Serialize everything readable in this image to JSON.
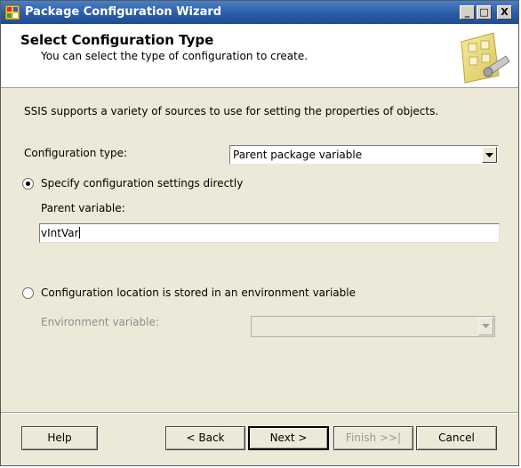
{
  "window": {
    "title": "Package Configuration Wizard",
    "controls": {
      "minimize": "_",
      "maximize": "□",
      "close": "X"
    }
  },
  "header": {
    "title": "Select Configuration Type",
    "subtitle": "You can select the type of configuration to create."
  },
  "body": {
    "description": "SSIS supports a variety of sources to use for setting the properties of objects.",
    "config_type_label": "Configuration type:",
    "config_type_value": "Parent package variable",
    "radio_direct": {
      "label": "Specify configuration settings directly",
      "selected": true
    },
    "parent_variable_label": "Parent variable:",
    "parent_variable_value": "vIntVar",
    "radio_env": {
      "label": "Configuration location is stored in an environment variable",
      "selected": false
    },
    "environment_variable_label": "Environment variable:",
    "environment_variable_value": ""
  },
  "buttons": {
    "help": "Help",
    "back": "< Back",
    "next": "Next >",
    "finish": "Finish >>|",
    "cancel": "Cancel"
  },
  "icons": {
    "app": "wizard-app-icon",
    "header_graphic": "wizard-graphic-icon",
    "dropdown": "chevron-down-icon"
  },
  "colors": {
    "titlebar": "#2a5ca6",
    "dialog_bg": "#ece9d8",
    "disabled_text": "#8e8e8e"
  }
}
